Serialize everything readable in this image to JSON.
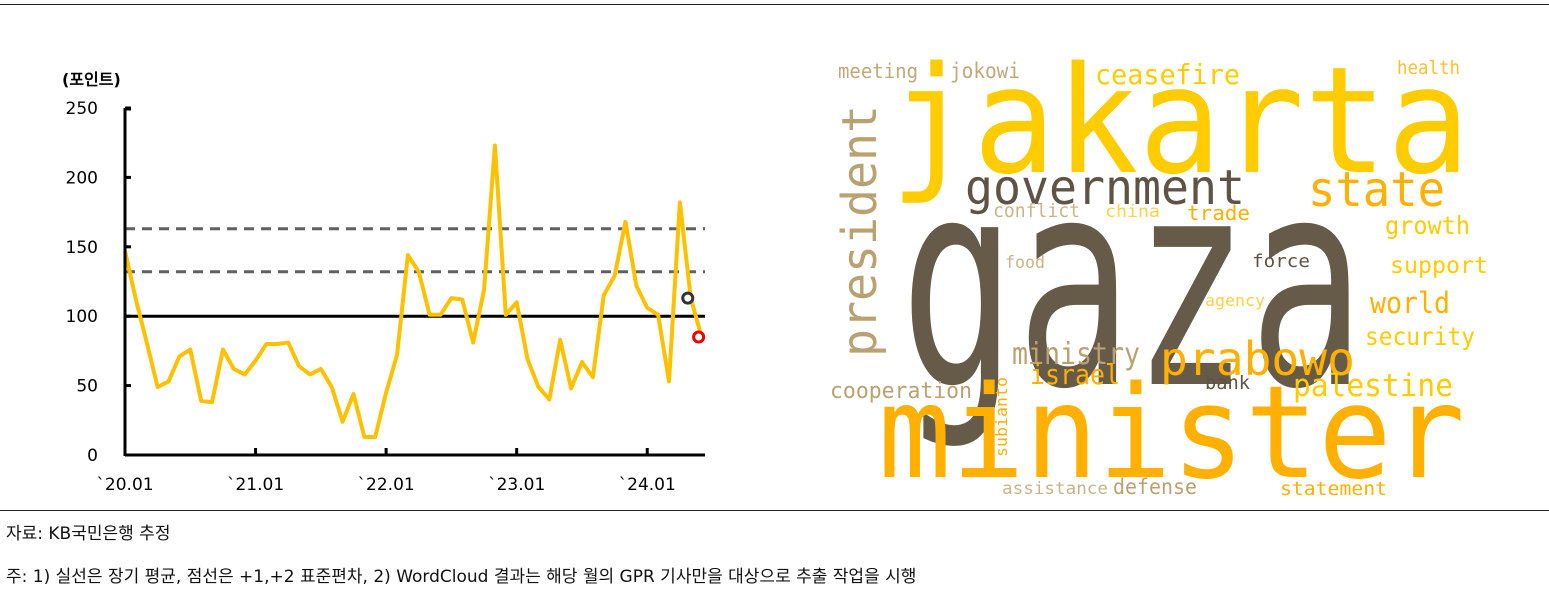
{
  "chart_data": {
    "type": "line",
    "ylabel": "(포인트)",
    "ylim": [
      0,
      250
    ],
    "yticks": [
      "0",
      "50",
      "100",
      "150",
      "200",
      "250"
    ],
    "xtick_labels": [
      "`20.01",
      "`21.01",
      "`22.01",
      "`23.01",
      "`24.01"
    ],
    "x": [
      "2020.01",
      "2020.02",
      "2020.03",
      "2020.04",
      "2020.05",
      "2020.06",
      "2020.07",
      "2020.08",
      "2020.09",
      "2020.10",
      "2020.11",
      "2020.12",
      "2021.01",
      "2021.02",
      "2021.03",
      "2021.04",
      "2021.05",
      "2021.06",
      "2021.07",
      "2021.08",
      "2021.09",
      "2021.10",
      "2021.11",
      "2021.12",
      "2022.01",
      "2022.02",
      "2022.03",
      "2022.04",
      "2022.05",
      "2022.06",
      "2022.07",
      "2022.08",
      "2022.09",
      "2022.10",
      "2022.11",
      "2022.12",
      "2023.01",
      "2023.02",
      "2023.03",
      "2023.04",
      "2023.05",
      "2023.06",
      "2023.07",
      "2023.08",
      "2023.09",
      "2023.10",
      "2023.11",
      "2023.12",
      "2024.01",
      "2024.02",
      "2024.03",
      "2024.04",
      "2024.05",
      "2024.06"
    ],
    "series": [
      {
        "color": "#ffc000",
        "values": [
          147,
          112,
          81,
          49,
          53,
          71,
          76,
          39,
          38,
          76,
          62,
          58,
          68,
          80,
          80,
          81,
          64,
          58,
          62,
          49,
          24,
          44,
          13,
          13,
          45,
          72,
          144,
          132,
          101,
          101,
          113,
          112,
          81,
          119,
          223,
          101,
          110,
          69,
          49,
          40,
          83,
          48,
          67,
          56,
          115,
          129,
          168,
          122,
          106,
          101,
          53,
          182,
          113,
          85
        ]
      }
    ],
    "reference_lines": [
      {
        "value": 100,
        "style": "solid",
        "color": "#000000"
      },
      {
        "value": 132,
        "style": "dashed",
        "color": "#606060"
      },
      {
        "value": 163,
        "style": "dashed",
        "color": "#606060"
      }
    ],
    "markers": [
      {
        "x": "2024.05",
        "y": 113,
        "color": "#333333"
      },
      {
        "x": "2024.06",
        "y": 85,
        "color": "#ee0000"
      }
    ],
    "grid": false
  },
  "wordcloud": {
    "words": [
      {
        "text": "gaza",
        "color": "#665a48"
      },
      {
        "text": "jakarta",
        "color": "#ffcc00"
      },
      {
        "text": "minister",
        "color": "#ffb000"
      },
      {
        "text": "government",
        "color": "#5e5344"
      },
      {
        "text": "state",
        "color": "#ffb000"
      },
      {
        "text": "president",
        "color": "#b9a172"
      },
      {
        "text": "prabowo",
        "color": "#ffb000"
      },
      {
        "text": "palestine",
        "color": "#ffcc00"
      },
      {
        "text": "ministry",
        "color": "#b9a172"
      },
      {
        "text": "israel",
        "color": "#ffb000"
      },
      {
        "text": "world",
        "color": "#ffb000"
      },
      {
        "text": "ceasefire",
        "color": "#ffcc00"
      },
      {
        "text": "security",
        "color": "#ffcc00"
      },
      {
        "text": "growth",
        "color": "#ffcc00"
      },
      {
        "text": "support",
        "color": "#ffcc00"
      },
      {
        "text": "cooperation",
        "color": "#b9a172"
      },
      {
        "text": "defense",
        "color": "#b9a172"
      },
      {
        "text": "statement",
        "color": "#ffb000"
      },
      {
        "text": "assistance",
        "color": "#c8b48a"
      },
      {
        "text": "trade",
        "color": "#ffb000"
      },
      {
        "text": "meeting",
        "color": "#c0a878"
      },
      {
        "text": "jokowi",
        "color": "#c0a878"
      },
      {
        "text": "health",
        "color": "#ffc030"
      },
      {
        "text": "conflict",
        "color": "#c8b48a"
      },
      {
        "text": "china",
        "color": "#ffd24a"
      },
      {
        "text": "food",
        "color": "#c8b48a"
      },
      {
        "text": "force",
        "color": "#5e5344"
      },
      {
        "text": "agency",
        "color": "#ffd040"
      },
      {
        "text": "bank",
        "color": "#5e5344"
      },
      {
        "text": "subianto",
        "color": "#ffb000"
      }
    ]
  },
  "footer": {
    "source": "자료: KB국민은행 추정",
    "note": "주: 1) 실선은 장기 평균, 점선은 +1,+2 표준편차, 2) WordCloud 결과는 해당 월의 GPR 기사만을 대상으로 추출 작업을 시행"
  }
}
